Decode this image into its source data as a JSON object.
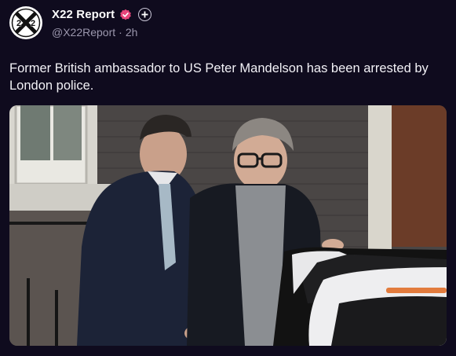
{
  "author": {
    "display_name": "X22 Report",
    "handle": "@X22Report",
    "separator": "·",
    "time_ago": "2h",
    "avatar_text": "X22",
    "verified_color": "#e8457a"
  },
  "post": {
    "text": "Former British ambassador to US Peter Mandelson has been arrested by London police."
  },
  "icons": {
    "verified": "verified-badge-icon",
    "follow": "plus-circle-icon"
  },
  "colors": {
    "background": "#0f0b1e",
    "secondary_text": "#9b97ad",
    "primary_text": "#ffffff"
  }
}
